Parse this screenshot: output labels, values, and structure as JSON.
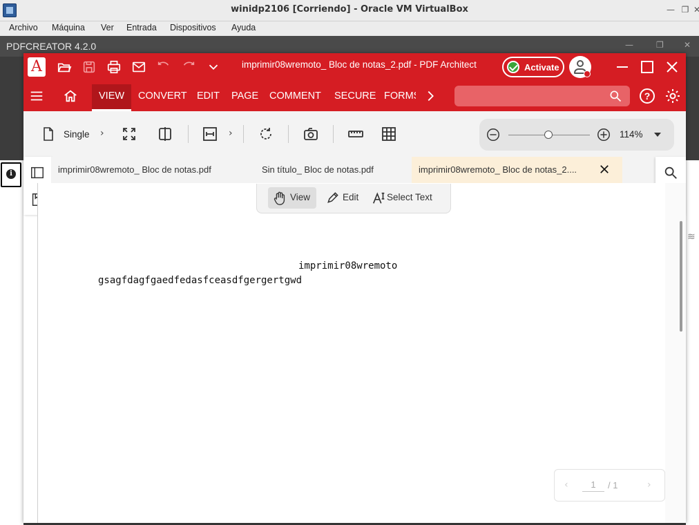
{
  "host": {
    "title": "winidp2106 [Corriendo] - Oracle VM VirtualBox",
    "menu": [
      "Archivo",
      "Máquina",
      "Ver",
      "Entrada",
      "Dispositivos",
      "Ayuda"
    ]
  },
  "guest": {
    "app_bar_title": "PDFCREATOR 4.2.0"
  },
  "app": {
    "logo_letter": "A",
    "document_title": "imprimir08wremoto_ Bloc de notas_2.pdf   -   PDF Architect",
    "activate_label": "Activate",
    "accent_color": "#d51d23",
    "ribbon_tabs": [
      "VIEW",
      "CONVERT",
      "EDIT",
      "PAGE",
      "COMMENT",
      "SECURE",
      "FORMS"
    ],
    "active_tab": "VIEW",
    "help_label": "?"
  },
  "toolbar": {
    "page_mode_label": "Single",
    "zoom_value": "114%",
    "zoom_level_fraction": 0.49
  },
  "document_tabs": [
    {
      "label": "imprimir08wremoto_ Bloc de notas.pdf",
      "active": false
    },
    {
      "label": "Sin título_ Bloc de notas.pdf",
      "active": false
    },
    {
      "label": "imprimir08wremoto_ Bloc de notas_2....",
      "active": true
    }
  ],
  "modes": {
    "view": "View",
    "edit": "Edit",
    "select_text": "Select Text",
    "active": "View"
  },
  "page": {
    "line1": "imprimir08wremoto",
    "line2": "gsagfdagfgaedfedasfceasdfgergertgwd"
  },
  "pager": {
    "current": "1",
    "total": "/ 1"
  }
}
